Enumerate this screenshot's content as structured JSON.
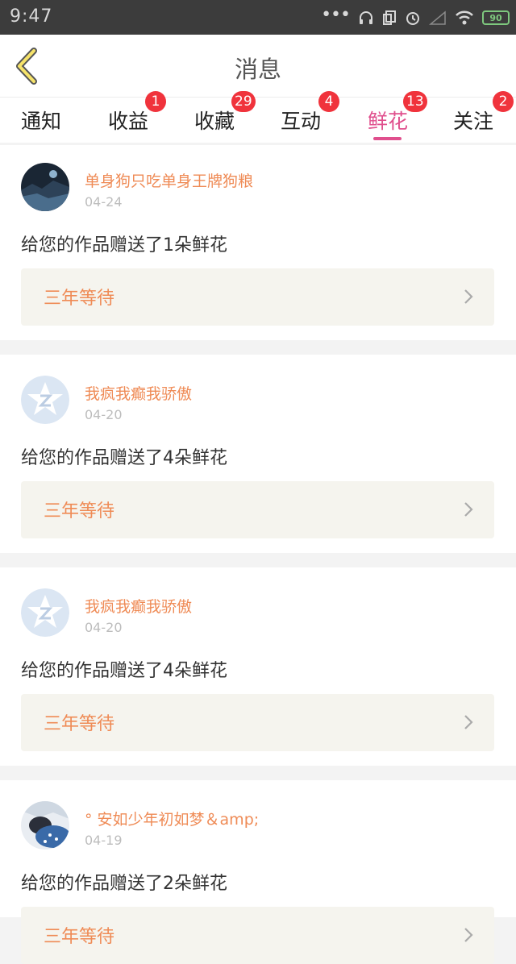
{
  "status_bar": {
    "time": "9:47",
    "battery": "90",
    "icons": [
      "dots-icon",
      "headset-icon",
      "screen-icon",
      "alarm-icon",
      "signal-icon",
      "wifi-icon",
      "battery-icon"
    ]
  },
  "header": {
    "title": "消息",
    "back_icon": "chevron-left-icon"
  },
  "tabs": [
    {
      "label": "通知",
      "badge": ""
    },
    {
      "label": "收益",
      "badge": "1"
    },
    {
      "label": "收藏",
      "badge": "29"
    },
    {
      "label": "互动",
      "badge": "4"
    },
    {
      "label": "鲜花",
      "badge": "13",
      "active": true
    },
    {
      "label": "关注",
      "badge": "2"
    }
  ],
  "colors": {
    "accent": "#e04f8d",
    "username": "#ef8b56",
    "badge": "#f0333c"
  },
  "messages": [
    {
      "username": "单身狗只吃单身王牌狗粮",
      "date": "04-24",
      "text": "给您的作品赠送了1朵鲜花",
      "work_title": "三年等待",
      "avatar": "dark-landscape-avatar"
    },
    {
      "username": "我疯我癫我骄傲",
      "date": "04-20",
      "text": "给您的作品赠送了4朵鲜花",
      "work_title": "三年等待",
      "avatar": "qzone-star-avatar"
    },
    {
      "username": "我疯我癫我骄傲",
      "date": "04-20",
      "text": "给您的作品赠送了4朵鲜花",
      "work_title": "三年等待",
      "avatar": "qzone-star-avatar"
    },
    {
      "username": "° 安如少年初如梦＆amp;",
      "date": "04-19",
      "text": "给您的作品赠送了2朵鲜花",
      "work_title": "三年等待",
      "avatar": "photo-avatar"
    }
  ]
}
